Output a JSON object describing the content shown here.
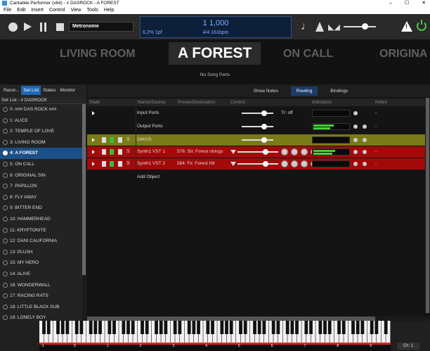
{
  "window": {
    "title": "Cantabile Performer (x64) - # DASROCK - A FOREST",
    "controls": [
      "–",
      "☐",
      "✕"
    ]
  },
  "menu": [
    "File",
    "Edit",
    "Insert",
    "Control",
    "View",
    "Tools",
    "Help"
  ],
  "toolbar": {
    "metronome_label": "Metronome",
    "position": "1 1,000",
    "time_signature": "4/4 161bpm",
    "load": "6,2%  1pf"
  },
  "song_bar": {
    "songs": [
      "LIVING ROOM",
      "A FOREST",
      "ON CALL",
      "ORIGINA"
    ],
    "active_song": "A FOREST",
    "parts_text": "No Song Parts"
  },
  "left_panel": {
    "tabs": [
      "Recor...",
      "Set List",
      "States",
      "Monitor"
    ],
    "active_tab": "Set List",
    "header": "Set List - # DASROCK",
    "items": [
      "0: ### DAS ROCK ###",
      "1: ALICE",
      "2: TEMPLE OF LOVE",
      "3: LIVING ROOM",
      "4: A FOREST",
      "5: ON CALL",
      "6: ORIGINAL SIN",
      "7: PAPILLON",
      "8: FLY AWAY",
      "9: BITTER END",
      "10: HAMMERHEAD",
      "11: KRYPTONITE",
      "12: DANI CALIFORNIA",
      "13: PLUSH",
      "15: MY HERO",
      "14: ALIVE",
      "16: WONDERWALL",
      "17: RACING RATS",
      "18: LITTLE BLACK SUB",
      "19: LONELY BOY"
    ],
    "selected_index": 4
  },
  "routing": {
    "tabs": [
      "Show Notes",
      "Routing",
      "Bindings"
    ],
    "active_tab": "Routing",
    "columns": [
      "State",
      "Name/Source",
      "Preset/Destination",
      "Control",
      "Indicators",
      "Notes"
    ],
    "rows": [
      {
        "name": "Input Ports",
        "preset": "",
        "extra": "Tr: off",
        "notes": "-",
        "style": "plain",
        "level": 0
      },
      {
        "name": "Output Ports",
        "preset": "",
        "extra": "",
        "notes": "-",
        "style": "plain",
        "level": 0.55
      },
      {
        "name": "DMXIS",
        "preset": "",
        "extra": "",
        "notes": "-",
        "style": "olive",
        "level": 0
      },
      {
        "name": "Synth1 VST 1",
        "preset": "576: Str. Forest strings",
        "extra": "",
        "notes": "-",
        "style": "red",
        "level": 0.6
      },
      {
        "name": "Synth1 VST 2",
        "preset": "584: Fx: Forest Hit",
        "extra": "",
        "notes": "-",
        "style": "red",
        "level": 0
      }
    ],
    "add_object_label": "Add Object"
  },
  "keyboard": {
    "ruler_labels": [
      "-1",
      "0",
      "1",
      "2",
      "3",
      "4",
      "5",
      "6",
      "7",
      "8",
      "9"
    ],
    "channel": "Ch: 1"
  },
  "colors": {
    "accent": "#1f67b3",
    "olive_row": "#7a7a17",
    "red_row": "#a20a0a",
    "meter": "#46d139",
    "power": "#53c24c"
  }
}
